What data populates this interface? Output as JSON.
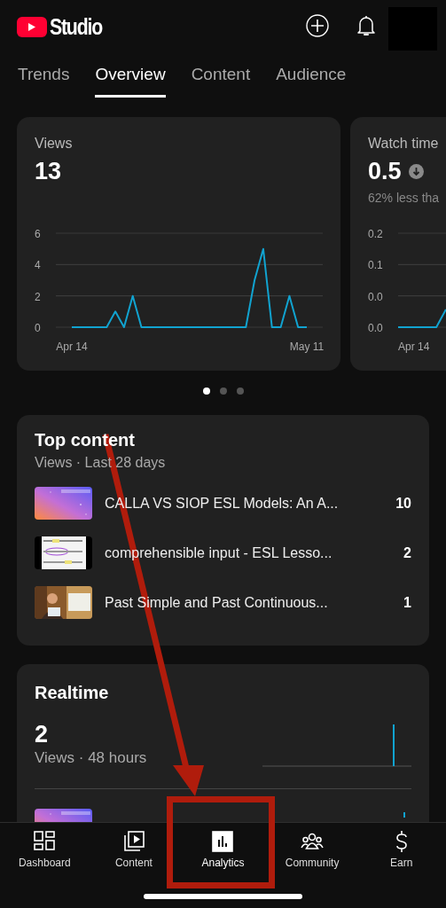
{
  "header": {
    "logo_text": "Studio"
  },
  "tabs": [
    {
      "label": "Trends",
      "selected": false
    },
    {
      "label": "Overview",
      "selected": true
    },
    {
      "label": "Content",
      "selected": false
    },
    {
      "label": "Audience",
      "selected": false
    }
  ],
  "metric_cards": [
    {
      "title": "Views",
      "value": "13",
      "chart_data": {
        "type": "line",
        "categories": [
          "Apr 14",
          null,
          null,
          null,
          null,
          null,
          null,
          null,
          null,
          null,
          null,
          null,
          null,
          null,
          null,
          null,
          null,
          null,
          null,
          null,
          null,
          null,
          null,
          null,
          null,
          null,
          null,
          "May 11"
        ],
        "ylim": [
          0,
          6
        ],
        "yticks": [
          0,
          2,
          4,
          6
        ],
        "values": [
          0,
          0,
          0,
          0,
          0,
          1,
          0,
          2,
          0,
          0,
          0,
          0,
          0,
          0,
          0,
          0,
          0,
          0,
          0,
          0,
          0,
          3,
          5,
          0,
          0,
          2,
          0,
          0
        ]
      }
    },
    {
      "title": "Watch time",
      "value": "0.5",
      "trend_down": true,
      "comparison": "62% less tha",
      "chart": {
        "y_labels": [
          "0.2",
          "0.1",
          "0.0",
          "0.0"
        ],
        "x_labels": [
          "Apr 14"
        ]
      }
    }
  ],
  "carousel_dots": [
    {
      "selected": true
    },
    {
      "selected": false
    },
    {
      "selected": false
    }
  ],
  "top_content": {
    "title": "Top content",
    "subtitle": "Views · Last 28 days",
    "items": [
      {
        "title": "CALLA VS SIOP ESL Models: An A...",
        "count": "10"
      },
      {
        "title": "comprehensible input - ESL Lesso...",
        "count": "2"
      },
      {
        "title": "Past Simple and Past Continuous...",
        "count": "1"
      }
    ]
  },
  "realtime": {
    "title": "Realtime",
    "value": "2",
    "subtitle": "Views · 48 hours"
  },
  "nav": [
    {
      "label": "Dashboard",
      "kind": "dashboard",
      "selected": false
    },
    {
      "label": "Content",
      "kind": "content",
      "selected": false
    },
    {
      "label": "Analytics",
      "kind": "analytics",
      "selected": true
    },
    {
      "label": "Community",
      "kind": "community",
      "selected": false
    },
    {
      "label": "Earn",
      "kind": "earn",
      "selected": false
    }
  ]
}
